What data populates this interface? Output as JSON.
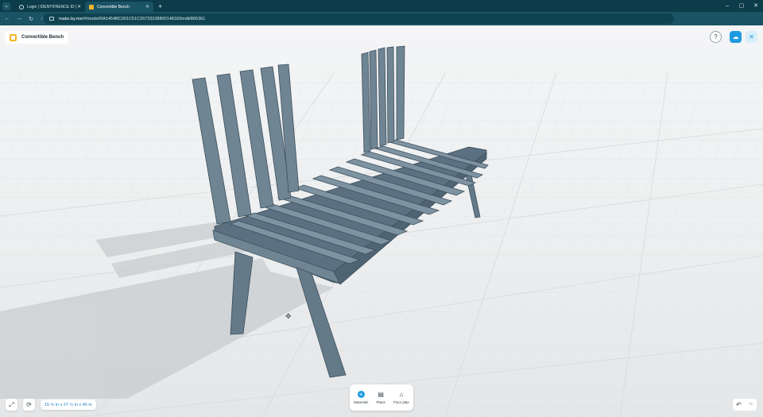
{
  "browser": {
    "tabs": [
      {
        "title": "Login | IDENTIFRENCE ID | Dec",
        "active": false,
        "icon": "globe-icon"
      },
      {
        "title": "Convertible Bench",
        "active": true,
        "icon": "make-logo-icon"
      }
    ],
    "new_tab_label": "+",
    "url_host": "make.by.me",
    "url_path": "/#/model/0A1454BC001C51C26733108800148183/edit/865361",
    "window_controls": {
      "minimize": "–",
      "maximize": "▢",
      "close": "✕"
    }
  },
  "app": {
    "title": "Convertible Bench",
    "help_label": "?",
    "accent_color": "#1e9be0",
    "toolbar": [
      {
        "label": "Materials",
        "icon": "add-circle-icon"
      },
      {
        "label": "Plans",
        "icon": "plans-icon"
      },
      {
        "label": "Floor plan",
        "icon": "floor-plan-icon"
      }
    ],
    "dimensions": "15 ¾ in x 27 ½ in x 45 in",
    "model_color": "#6e8494"
  }
}
